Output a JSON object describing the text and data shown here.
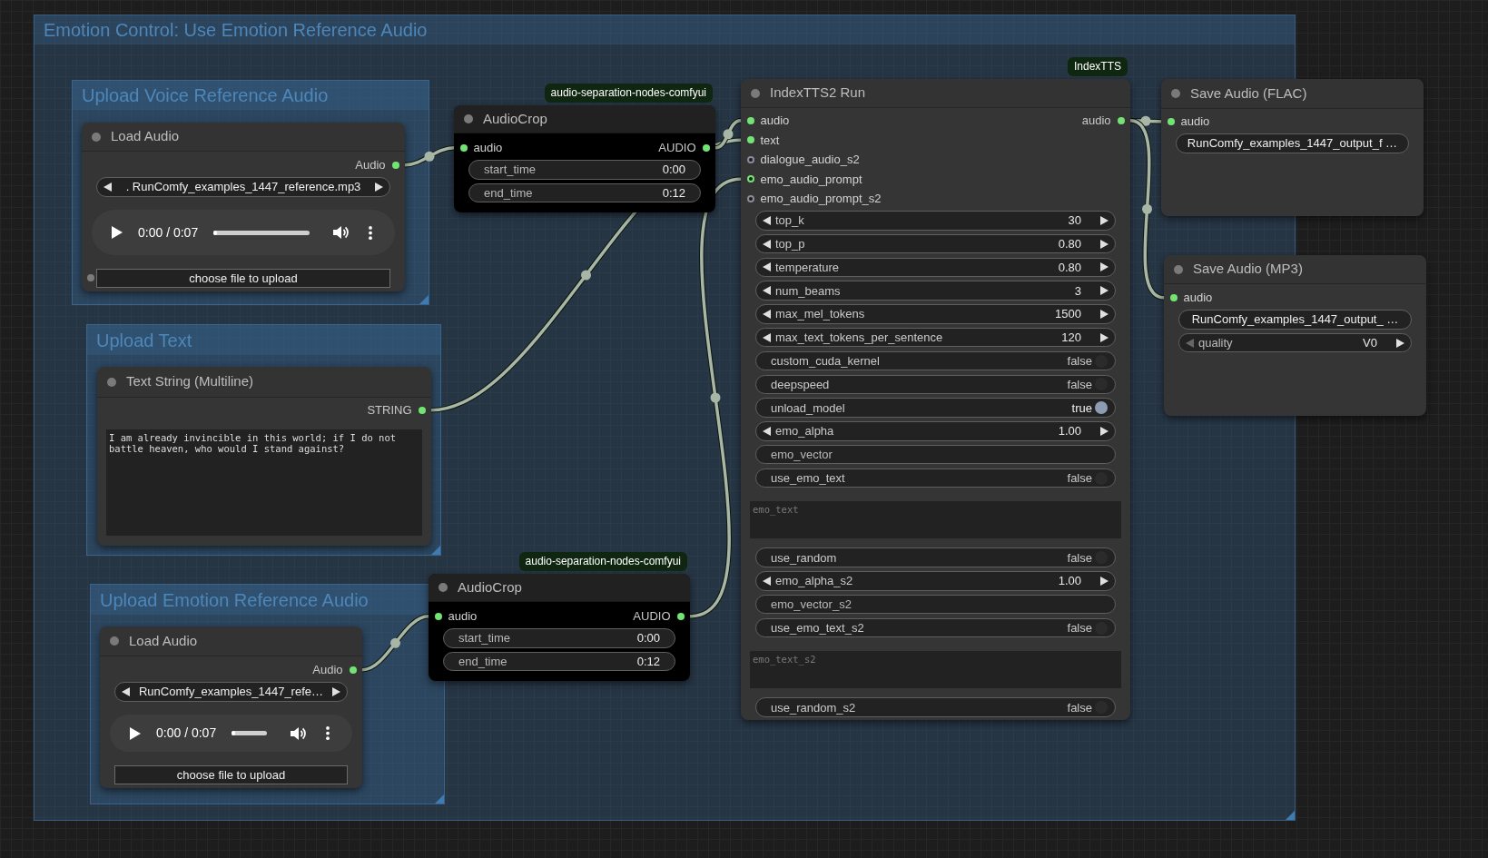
{
  "groups": [
    {
      "title": "Emotion Control: Use Emotion Reference Audio"
    },
    {
      "title": "Upload Voice Reference Audio"
    },
    {
      "title": "Upload Text"
    },
    {
      "title": "Upload Emotion Reference Audio"
    }
  ],
  "nodes": [
    {
      "title": "Load Audio",
      "color": "#353535",
      "outputs": [
        {
          "label": "Audio",
          "connected": true
        }
      ],
      "widgets": [
        {
          "kind": "combo",
          "value": ". RunComfy_examples_1447_reference.mp3",
          "prev_disabled": false
        },
        {
          "kind": "audio_player",
          "time": "0:00 / 0:07",
          "level": 0
        },
        {
          "kind": "button",
          "label": "choose file to upload",
          "socket_connected": false
        }
      ]
    },
    {
      "title": "Text String (Multiline)",
      "color": "#353535",
      "outputs": [
        {
          "label": "STRING",
          "connected": true
        }
      ],
      "widgets": [
        {
          "kind": "textarea",
          "value": "I am already invincible in this world; if I do not battle heaven, who would I stand against?"
        }
      ]
    },
    {
      "title": "Load Audio",
      "color": "#353535",
      "outputs": [
        {
          "label": "Audio",
          "connected": true
        }
      ],
      "widgets": [
        {
          "kind": "combo",
          "value": "RunComfy_examples_1447_refe…",
          "prev_disabled": false
        },
        {
          "kind": "audio_player",
          "time": "0:00 / 0:07",
          "level": 0
        },
        {
          "kind": "button",
          "label": "choose file to upload"
        }
      ]
    },
    {
      "title": "AudioCrop",
      "badge": "audio-separation-nodes-comfyui",
      "color": "#000000",
      "inputs": [
        {
          "label": "audio",
          "optional": false,
          "connected": true
        }
      ],
      "outputs": [
        {
          "label": "AUDIO",
          "connected": true
        }
      ],
      "widgets": [
        {
          "kind": "string",
          "label": "start_time",
          "value": "0:00"
        },
        {
          "kind": "string",
          "label": "end_time",
          "value": "0:12"
        }
      ]
    },
    {
      "title": "AudioCrop",
      "badge": "audio-separation-nodes-comfyui",
      "color": "#000000",
      "inputs": [
        {
          "label": "audio",
          "optional": false,
          "connected": true
        }
      ],
      "outputs": [
        {
          "label": "AUDIO",
          "connected": true
        }
      ],
      "widgets": [
        {
          "kind": "string",
          "label": "start_time",
          "value": "0:00"
        },
        {
          "kind": "string",
          "label": "end_time",
          "value": "0:12"
        }
      ]
    },
    {
      "title": "IndexTTS2 Run",
      "badge": "IndexTTS",
      "color": "#353535",
      "inputs": [
        {
          "label": "audio",
          "optional": false,
          "connected": true
        },
        {
          "label": "text",
          "optional": false,
          "connected": true
        },
        {
          "label": "dialogue_audio_s2",
          "optional": true,
          "connected": false
        },
        {
          "label": "emo_audio_prompt",
          "optional": true,
          "connected": true
        },
        {
          "label": "emo_audio_prompt_s2",
          "optional": true,
          "connected": false
        }
      ],
      "outputs": [
        {
          "label": "audio",
          "connected": true
        }
      ],
      "widgets": [
        {
          "kind": "number",
          "label": "top_k",
          "value": "30"
        },
        {
          "kind": "number",
          "label": "top_p",
          "value": "0.80"
        },
        {
          "kind": "number",
          "label": "temperature",
          "value": "0.80"
        },
        {
          "kind": "number",
          "label": "num_beams",
          "value": "3"
        },
        {
          "kind": "number",
          "label": "max_mel_tokens",
          "value": "1500"
        },
        {
          "kind": "number",
          "label": "max_text_tokens_per_sentence",
          "value": "120"
        },
        {
          "kind": "toggle",
          "label": "custom_cuda_kernel",
          "value": "false",
          "on": false
        },
        {
          "kind": "toggle",
          "label": "deepspeed",
          "value": "false",
          "on": false
        },
        {
          "kind": "toggle",
          "label": "unload_model",
          "value": "true",
          "on": true
        },
        {
          "kind": "number",
          "label": "emo_alpha",
          "value": "1.00"
        },
        {
          "kind": "string",
          "label": "emo_vector"
        },
        {
          "kind": "toggle",
          "label": "use_emo_text",
          "value": "false",
          "on": false
        },
        {
          "kind": "textarea",
          "placeholder": "emo_text"
        },
        {
          "kind": "toggle",
          "label": "use_random",
          "value": "false",
          "on": false
        },
        {
          "kind": "number",
          "label": "emo_alpha_s2",
          "value": "1.00"
        },
        {
          "kind": "string",
          "label": "emo_vector_s2"
        },
        {
          "kind": "toggle",
          "label": "use_emo_text_s2",
          "value": "false",
          "on": false
        },
        {
          "kind": "textarea",
          "placeholder": "emo_text_s2"
        },
        {
          "kind": "toggle",
          "label": "use_random_s2",
          "value": "false",
          "on": false
        }
      ]
    },
    {
      "title": "Save Audio (FLAC)",
      "color": "#353535",
      "inputs": [
        {
          "label": "audio",
          "optional": false,
          "connected": true
        }
      ],
      "widgets": [
        {
          "kind": "string",
          "value": "RunComfy_examples_1447_output_f …"
        }
      ]
    },
    {
      "title": "Save Audio (MP3)",
      "color": "#353535",
      "inputs": [
        {
          "label": "audio",
          "optional": false,
          "connected": true
        }
      ],
      "widgets": [
        {
          "kind": "string",
          "value": "RunComfy_examples_1447_output_ …"
        },
        {
          "kind": "combo",
          "label": "quality",
          "value": "V0",
          "prev_disabled": true
        }
      ]
    }
  ]
}
